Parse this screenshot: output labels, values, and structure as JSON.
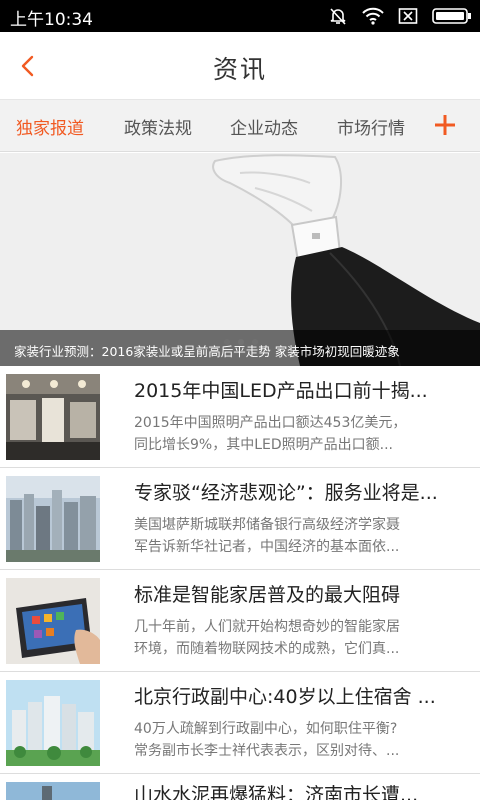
{
  "status_bar": {
    "time": "上午10:34",
    "icons": [
      "mute-icon",
      "wifi-icon",
      "close-box-icon",
      "battery-icon"
    ]
  },
  "header": {
    "title": "资讯",
    "back_icon": "chevron-left-icon"
  },
  "tabs": {
    "items": [
      {
        "label": "独家报道",
        "active": true
      },
      {
        "label": "政策法规",
        "active": false
      },
      {
        "label": "企业动态",
        "active": false
      },
      {
        "label": "市场行情",
        "active": false
      }
    ],
    "add_icon": "plus-icon"
  },
  "banner": {
    "caption": "家装行业预测：2016家装业或呈前高后平走势 家装市场初现回暖迹象",
    "slide_count": 3,
    "active_slide": 1
  },
  "news": [
    {
      "title": "2015年中国LED产品出口前十揭...",
      "summary_line1": "2015年中国照明产品出口额达453亿美元，",
      "summary_line2": "同比增长9%，其中LED照明产品出口额..."
    },
    {
      "title": "专家驳“经济悲观论”：服务业将是...",
      "summary_line1": "美国堪萨斯城联邦储备银行高级经济学家聂",
      "summary_line2": "军告诉新华社记者，中国经济的基本面依..."
    },
    {
      "title": "标准是智能家居普及的最大阻碍",
      "summary_line1": "几十年前，人们就开始构想奇妙的智能家居",
      "summary_line2": "环境，而随着物联网技术的成熟，它们真..."
    },
    {
      "title": "北京行政副中心:40岁以上住宿舍 ...",
      "summary_line1": "40万人疏解到行政副中心，如何职住平衡?",
      "summary_line2": "常务副市长李士祥代表表示，区别对待、..."
    },
    {
      "title": "山水水泥再爆猛料：济南市长遭...",
      "summary_line1": "",
      "summary_line2": ""
    }
  ],
  "colors": {
    "accent": "#f15a22",
    "status_bar": "#000000",
    "tab_bg": "#f2f2f2"
  }
}
